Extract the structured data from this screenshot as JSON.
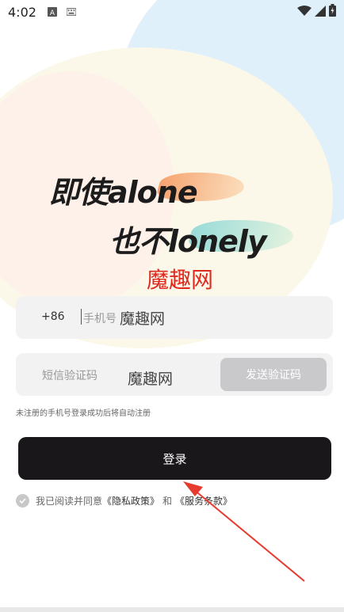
{
  "status_bar": {
    "time": "4:02",
    "icons": [
      "font-a-icon",
      "keyboard-icon",
      "wifi-icon",
      "signal-icon",
      "battery-icon"
    ]
  },
  "slogan": {
    "line1": "即使alone",
    "line2": "也不lonely"
  },
  "watermark": "魔趣网",
  "phone_field": {
    "country_code": "+86",
    "placeholder": "手机号",
    "overlay": "魔趣网"
  },
  "code_field": {
    "placeholder": "短信验证码",
    "overlay": "魔趣网",
    "send_label": "发送验证码"
  },
  "hint": "未注册的手机号登录成功后将自动注册",
  "login_label": "登录",
  "agreement": {
    "prefix": "我已阅读并同意",
    "privacy": "《隐私政策》",
    "and": "和",
    "terms": "《服务条款》"
  },
  "colors": {
    "login_bg": "#1a171b",
    "send_bg": "#c9c9cc",
    "watermark": "#e02a20",
    "annotation_arrow": "#e63b2e"
  }
}
